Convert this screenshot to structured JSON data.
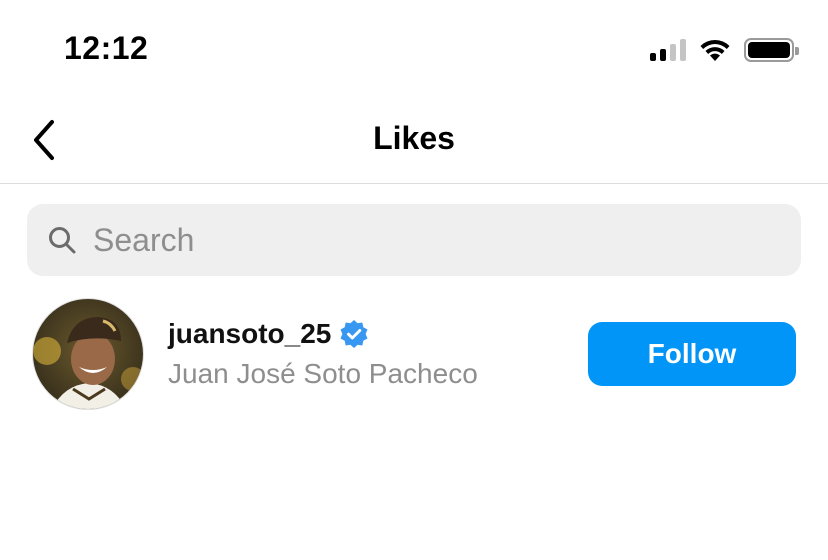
{
  "status_bar": {
    "time": "12:12",
    "icons": [
      "cellular-signal-icon",
      "wifi-icon",
      "battery-icon"
    ]
  },
  "nav": {
    "title": "Likes",
    "back_icon": "chevron-left-icon"
  },
  "search": {
    "placeholder": "Search",
    "value": "",
    "icon": "search-icon"
  },
  "likes": [
    {
      "username": "juansoto_25",
      "full_name": "Juan José Soto Pacheco",
      "verified": true,
      "action_label": "Follow"
    }
  ],
  "colors": {
    "follow_button": "#0095f6",
    "verified_badge": "#3897f0",
    "secondary_text": "#8e8e8e",
    "search_bg": "#efefef"
  }
}
